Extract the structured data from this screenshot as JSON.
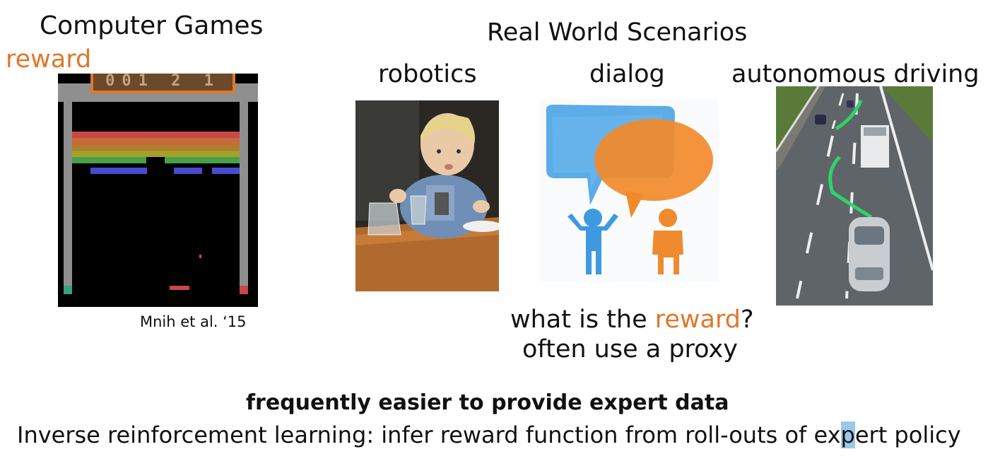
{
  "left": {
    "title": "Computer Games",
    "reward_label": "reward",
    "score": "001 2 1",
    "citation": "Mnih et al. ‘15"
  },
  "right": {
    "title": "Real World Scenarios",
    "labels": {
      "robotics": "robotics",
      "dialog": "dialog",
      "driving": "autonomous driving"
    },
    "question_pre": "what is the ",
    "question_word": "reward",
    "question_post": "?",
    "proxy": "often use a proxy"
  },
  "bottom": {
    "headline": "frequently easier to provide expert data",
    "irl_a": "Inverse reinforcement learning: infer reward function from roll-outs of ex",
    "irl_b": "p",
    "irl_c": "ert policy"
  },
  "colors": {
    "accent": "#e0772a",
    "game_bg": "#000000",
    "bubble_blue": "#3d9ae0",
    "bubble_orange": "#ef8a2e"
  }
}
